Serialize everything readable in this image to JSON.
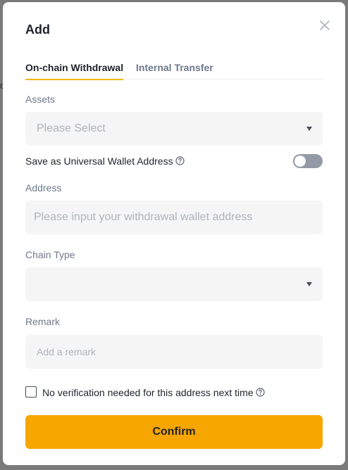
{
  "backdrop": {
    "fragment": "d"
  },
  "dialog": {
    "title": "Add",
    "close_icon": "close-icon"
  },
  "tabs": [
    {
      "label": "On-chain Withdrawal",
      "active": true
    },
    {
      "label": "Internal Transfer",
      "active": false
    }
  ],
  "assets": {
    "label": "Assets",
    "placeholder": "Please Select"
  },
  "universal_wallet": {
    "label": "Save as Universal Wallet Address",
    "enabled": false
  },
  "address": {
    "label": "Address",
    "placeholder": "Please input your withdrawal wallet address",
    "value": ""
  },
  "chain_type": {
    "label": "Chain Type",
    "value": ""
  },
  "remark": {
    "label": "Remark",
    "placeholder": "Add a remark",
    "value": ""
  },
  "no_verification": {
    "label": "No verification needed for this address next time",
    "checked": false
  },
  "confirm_label": "Confirm",
  "colors": {
    "accent": "#f0b90b",
    "button": "#f7a600",
    "field_bg": "#f5f5f5",
    "toggle_off": "#929aa5"
  }
}
